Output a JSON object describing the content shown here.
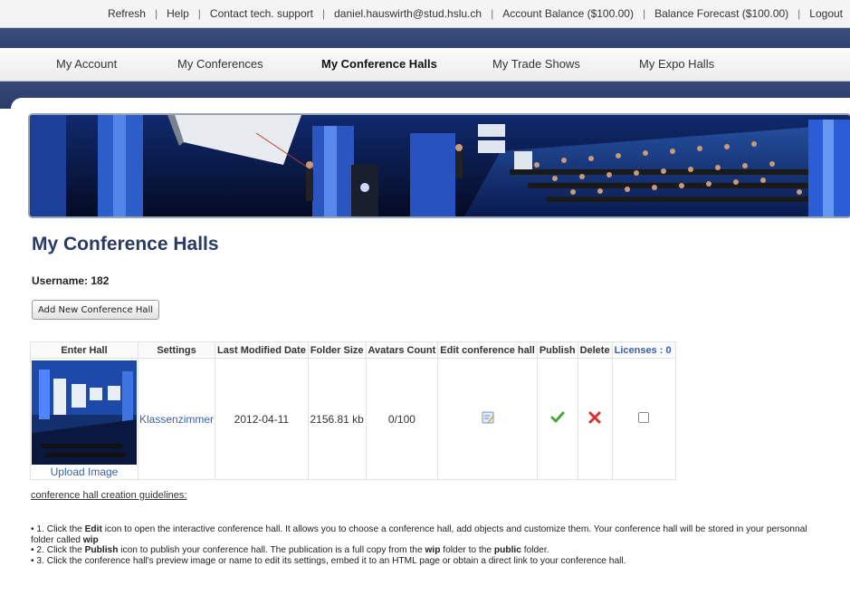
{
  "topbar": {
    "refresh": "Refresh",
    "help": "Help",
    "contact": "Contact tech. support",
    "email": "daniel.hauswirth@stud.hslu.ch",
    "account_balance": "Account Balance ($100.00)",
    "balance_forecast": "Balance Forecast ($100.00)",
    "logout": "Logout"
  },
  "nav": {
    "items": [
      {
        "label": "My Account"
      },
      {
        "label": "My Conferences"
      },
      {
        "label": "My Conference Halls"
      },
      {
        "label": "My Trade Shows"
      },
      {
        "label": "My Expo Halls"
      }
    ],
    "active": "My Conference Halls"
  },
  "page": {
    "title": "My Conference Halls",
    "username": "Username: 182",
    "add_button": "Add New Conference Hall"
  },
  "table": {
    "headers": {
      "enter_hall": "Enter Hall",
      "settings": "Settings",
      "last_modified": "Last Modified Date",
      "folder_size": "Folder Size",
      "avatars_count": "Avatars Count",
      "edit": "Edit conference hall",
      "publish": "Publish",
      "delete": "Delete",
      "licenses": "Licenses : 0"
    },
    "rows": [
      {
        "upload": "Upload Image",
        "name": "Klassenzimmer",
        "date": "2012-04-11",
        "size": "2156.81 kb",
        "avatars": "0/100"
      }
    ]
  },
  "guidelines": {
    "link": "conference hall creation guidelines:",
    "items": [
      {
        "a": "1. Click the ",
        "b": "Edit",
        "c": " icon to open the interactive conference hall. It allows you to choose a conference hall, add objects and customize them. Your conference hall will be stored in your personnal folder called ",
        "d": "wip"
      },
      {
        "a": "2. Click the ",
        "b": "Publish",
        "c": " icon to publish your conference hall. The publication is a full copy from the ",
        "d": "wip",
        "e": " folder to the ",
        "f": "public",
        "g": " folder."
      },
      {
        "a": "3. Click the conference hall's preview image or name to edit its settings, embed it to an HTML page or obtain a direct link to your conference hall."
      }
    ]
  },
  "colors": {
    "accent_blue": "#3b62a8",
    "header_band": "#2f4272",
    "title": "#2a3a66",
    "publish_green": "#4aa43a",
    "delete_red": "#d9322a"
  }
}
